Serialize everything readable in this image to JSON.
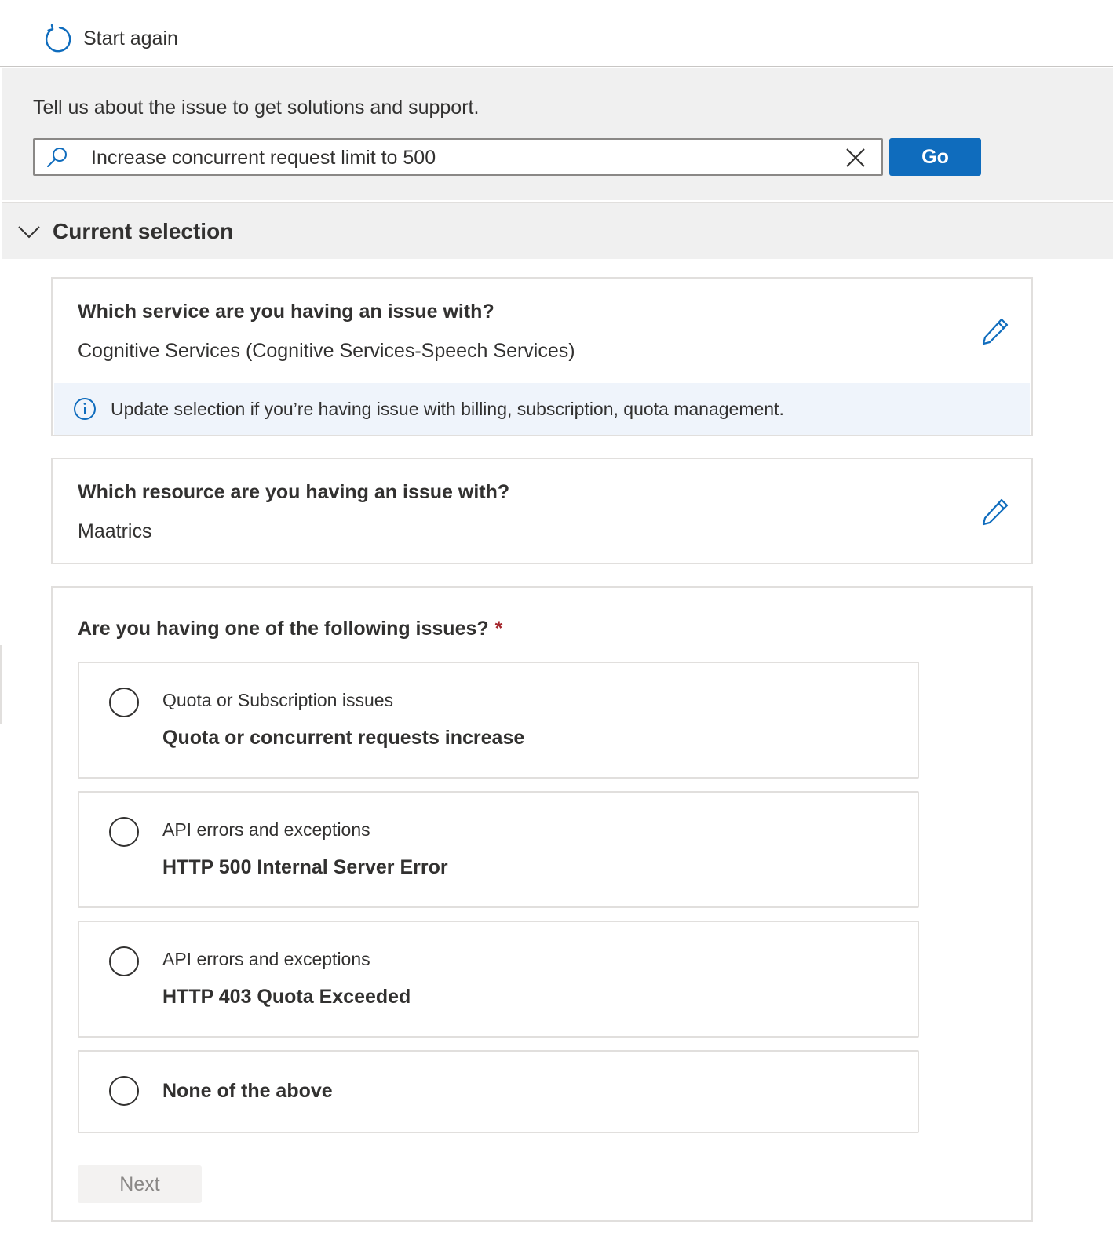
{
  "topbar": {
    "start_again_label": "Start again"
  },
  "search": {
    "prompt": "Tell us about the issue to get solutions and support.",
    "value": "Increase concurrent request limit to 500",
    "go_label": "Go"
  },
  "current_selection": {
    "title": "Current selection",
    "service": {
      "question": "Which service are you having an issue with?",
      "answer": "Cognitive Services (Cognitive Services-Speech Services)",
      "info": "Update selection if you’re having issue with billing, subscription, quota management."
    },
    "resource": {
      "question": "Which resource are you having an issue with?",
      "answer": "Maatrics"
    }
  },
  "issues": {
    "question": "Are you having one of the following issues?",
    "required_mark": "*",
    "options": [
      {
        "category": "Quota or Subscription issues",
        "label": "Quota or concurrent requests increase"
      },
      {
        "category": "API errors and exceptions",
        "label": "HTTP 500 Internal Server Error"
      },
      {
        "category": "API errors and exceptions",
        "label": "HTTP 403 Quota Exceeded"
      },
      {
        "category": "",
        "label": "None of the above"
      }
    ],
    "next_label": "Next"
  },
  "colors": {
    "accent": "#0f6cbd",
    "panel": "#f0f0f0",
    "info_bg": "#eff4fb",
    "required": "#a4262c"
  },
  "icons": [
    "refresh-icon",
    "search-icon",
    "close-icon",
    "chevron-down-icon",
    "edit-pencil-icon",
    "info-icon"
  ]
}
